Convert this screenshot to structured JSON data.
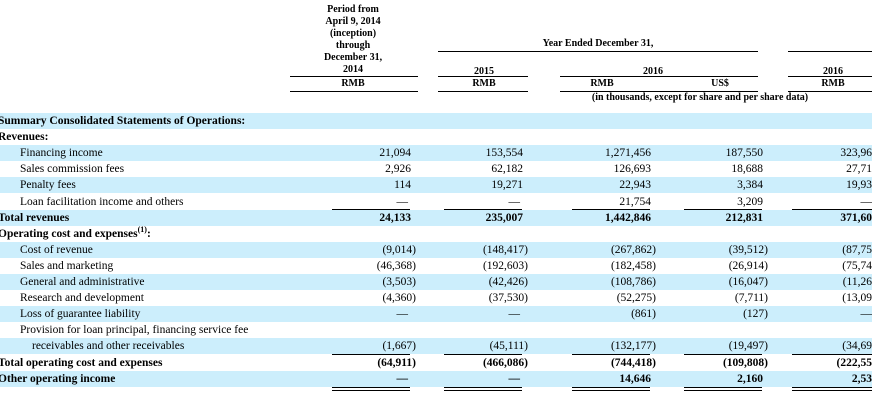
{
  "header": {
    "col1_lines": [
      "Period from",
      "April 9, 2014",
      "(inception)",
      "through",
      "December 31,",
      "2014"
    ],
    "col1_currency": "RMB",
    "span_title": "Year Ended December 31,",
    "col2_year": "2015",
    "col2_currency": "RMB",
    "col3_year": "2016",
    "col3_currency": "RMB",
    "col4_currency": "US$",
    "col5_year": "2016",
    "col5_currency": "RMB",
    "units_note": "(in thousands, except for share and per share data)"
  },
  "rows": [
    {
      "label": "Summary Consolidated Statements of Operations:",
      "level": 0,
      "bold": true,
      "values": [
        "",
        "",
        "",
        "",
        ""
      ]
    },
    {
      "label": "Revenues:",
      "level": 0,
      "bold": true,
      "values": [
        "",
        "",
        "",
        "",
        ""
      ]
    },
    {
      "label": "Financing income",
      "level": 1,
      "bold": false,
      "values": [
        "21,094",
        "153,554",
        "1,271,456",
        "187,550",
        "323,96"
      ]
    },
    {
      "label": "Sales commission fees",
      "level": 1,
      "bold": false,
      "values": [
        "2,926",
        "62,182",
        "126,693",
        "18,688",
        "27,71"
      ]
    },
    {
      "label": "Penalty fees",
      "level": 1,
      "bold": false,
      "values": [
        "114",
        "19,271",
        "22,943",
        "3,384",
        "19,93"
      ]
    },
    {
      "label": "Loan facilitation income and others",
      "level": 1,
      "bold": false,
      "values": [
        "—",
        "—",
        "21,754",
        "3,209",
        "—"
      ]
    },
    {
      "label": "Total revenues",
      "level": 0,
      "bold": true,
      "values": [
        "24,133",
        "235,007",
        "1,442,846",
        "212,831",
        "371,60"
      ]
    },
    {
      "label": "Operating cost and expenses",
      "level": 0,
      "bold": true,
      "footnote": "(1)",
      "suffix": ":",
      "values": [
        "",
        "",
        "",
        "",
        ""
      ]
    },
    {
      "label": "Cost of revenue",
      "level": 1,
      "bold": false,
      "values": [
        "(9,014)",
        "(148,417)",
        "(267,862)",
        "(39,512)",
        "(87,75"
      ]
    },
    {
      "label": "Sales and marketing",
      "level": 1,
      "bold": false,
      "values": [
        "(46,368)",
        "(192,603)",
        "(182,458)",
        "(26,914)",
        "(75,74"
      ]
    },
    {
      "label": "General and administrative",
      "level": 1,
      "bold": false,
      "values": [
        "(3,503)",
        "(42,426)",
        "(108,786)",
        "(16,047)",
        "(11,26"
      ]
    },
    {
      "label": "Research and development",
      "level": 1,
      "bold": false,
      "values": [
        "(4,360)",
        "(37,530)",
        "(52,275)",
        "(7,711)",
        "(13,09"
      ]
    },
    {
      "label": "Loss of guarantee liability",
      "level": 1,
      "bold": false,
      "values": [
        "—",
        "—",
        "(861)",
        "(127)",
        "—"
      ]
    },
    {
      "label": "Provision for loan principal, financing service fee",
      "level": 1,
      "bold": false,
      "values": [
        "",
        "",
        "",
        "",
        ""
      ]
    },
    {
      "label": "receivables and other receivables",
      "level": 2,
      "bold": false,
      "values": [
        "(1,667)",
        "(45,111)",
        "(132,177)",
        "(19,497)",
        "(34,69"
      ]
    },
    {
      "label": "Total operating cost and expenses",
      "level": 0,
      "bold": true,
      "values": [
        "(64,911)",
        "(466,086)",
        "(744,418)",
        "(109,808)",
        "(222,55"
      ]
    },
    {
      "label": "Other operating income",
      "level": 0,
      "bold": true,
      "values": [
        "—",
        "—",
        "14,646",
        "2,160",
        "2,53"
      ]
    }
  ]
}
